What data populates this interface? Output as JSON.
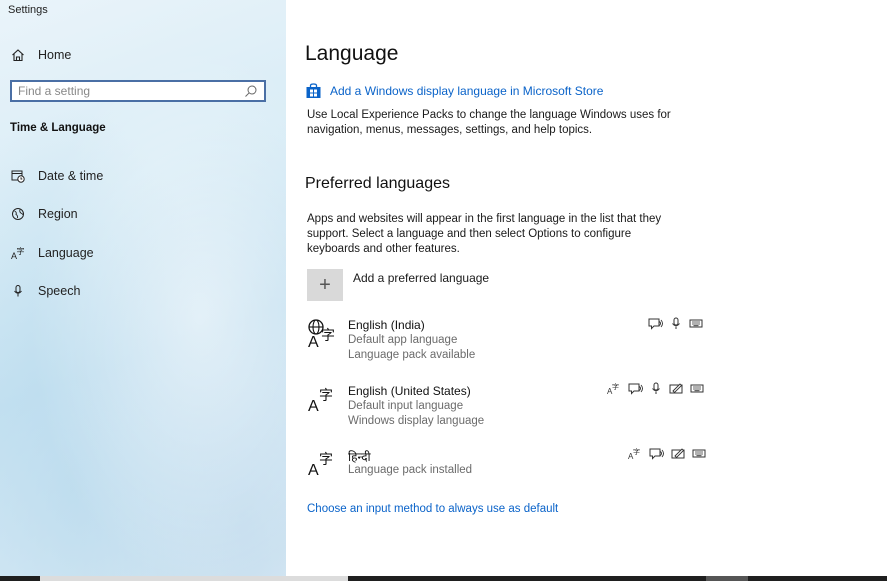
{
  "window": {
    "title": "Settings"
  },
  "sidebar": {
    "home_label": "Home",
    "search_placeholder": "Find a setting",
    "section_title": "Time & Language",
    "items": [
      {
        "label": "Date & time",
        "icon": "calendar-clock-icon"
      },
      {
        "label": "Region",
        "icon": "globe-icon"
      },
      {
        "label": "Language",
        "icon": "language-icon"
      },
      {
        "label": "Speech",
        "icon": "microphone-icon"
      }
    ]
  },
  "main": {
    "title": "Language",
    "store_link": "Add a Windows display language in Microsoft Store",
    "store_desc_1": "Use Local Experience Packs to change the language Windows uses for",
    "store_desc_2": "navigation, menus, messages, settings, and help topics.",
    "preferred_title": "Preferred languages",
    "preferred_desc_1": "Apps and websites will appear in the first language in the list that they",
    "preferred_desc_2": "support. Select a language and then select Options to configure",
    "preferred_desc_3": "keyboards and other features.",
    "add_language": "Add a preferred language",
    "languages": [
      {
        "name": "English (India)",
        "line1": "Default app language",
        "line2": "Language pack available",
        "features": [
          "text-to-speech-icon",
          "microphone-icon",
          "keyboard-icon"
        ]
      },
      {
        "name": "English (United States)",
        "line1": "Default input language",
        "line2": "Windows display language",
        "features": [
          "display-language-icon",
          "text-to-speech-icon",
          "microphone-icon",
          "handwriting-icon",
          "keyboard-icon"
        ]
      },
      {
        "name": "हिन्दी",
        "line1": "Language pack installed",
        "features": [
          "display-language-icon",
          "text-to-speech-icon",
          "handwriting-icon",
          "keyboard-icon"
        ]
      }
    ],
    "footer_link": "Choose an input method to always use as default"
  },
  "colors": {
    "accent": "#0a63c9",
    "search_border": "#4a6fa5"
  }
}
